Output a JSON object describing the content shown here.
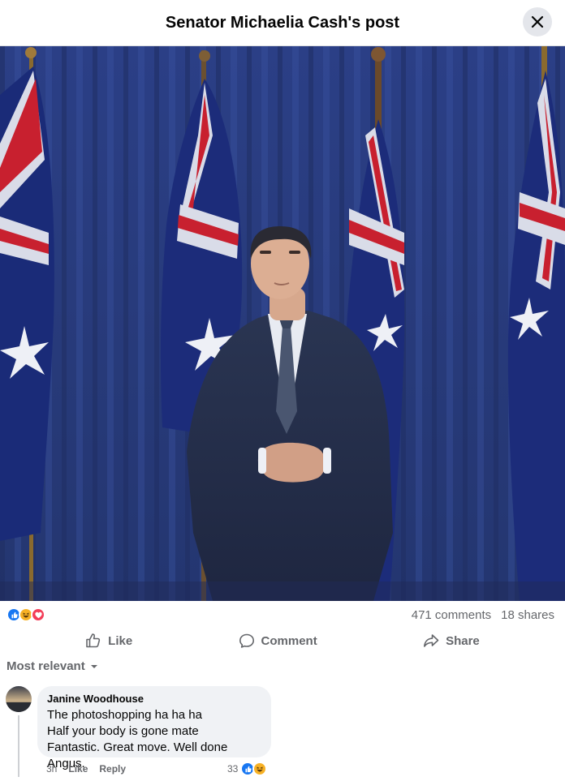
{
  "header": {
    "title": "Senator Michaelia Cash's post"
  },
  "icons": {
    "close": "close-icon",
    "like": "like-icon",
    "comment": "comment-icon",
    "share": "share-icon",
    "sort": "chevron-down-icon",
    "reaction_like": "like-reaction-icon",
    "reaction_haha": "haha-reaction-icon",
    "reaction_love": "love-reaction-icon"
  },
  "colors": {
    "like_blue": "#1877f2",
    "haha_yellow": "#f7b125",
    "love_red": "#f33e58",
    "muted": "#65676b"
  },
  "post": {
    "stats": {
      "comments": "471 comments",
      "shares": "18 shares"
    },
    "actions": {
      "like": "Like",
      "comment": "Comment",
      "share": "Share"
    }
  },
  "comments": {
    "sort_label": "Most relevant",
    "items": [
      {
        "author": "Janine Woodhouse",
        "lines": [
          "The photoshopping ha ha ha",
          "Half your body is gone mate",
          "Fantastic. Great move. Well done Angus."
        ],
        "time": "3h",
        "like_label": "Like",
        "reply_label": "Reply",
        "reaction_count": "33"
      }
    ]
  }
}
